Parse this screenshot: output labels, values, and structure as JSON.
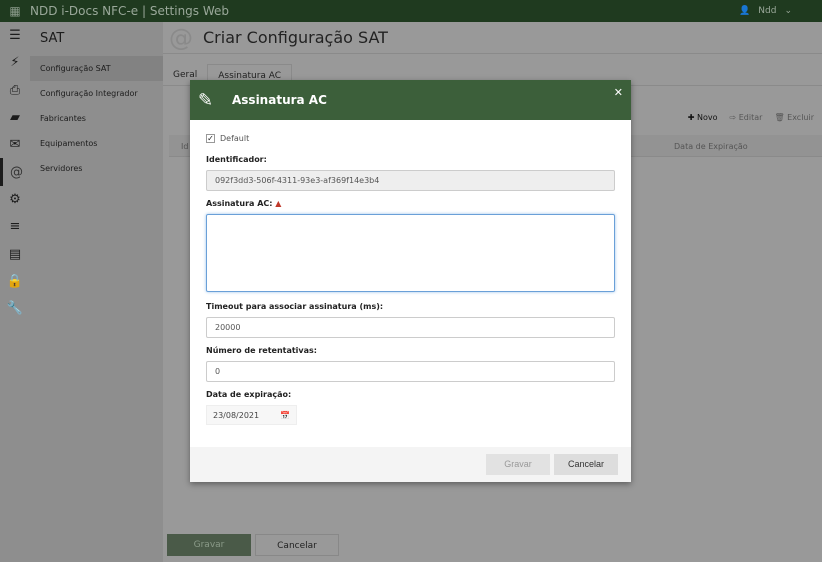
{
  "app": {
    "title": "NDD i-Docs NFC-e | Settings Web",
    "user": "Ndd"
  },
  "iconbar": [
    "menu-icon",
    "plug-icon",
    "printer-icon",
    "folder-icon",
    "envelope-icon",
    "at-icon",
    "gear-icon",
    "sliders-icon",
    "server-icon",
    "lock-icon",
    "wrench-icon"
  ],
  "nav": {
    "title": "SAT",
    "items": [
      "Configuração SAT",
      "Configuração Integrador",
      "Fabricantes",
      "Equipamentos",
      "Servidores"
    ],
    "selected": "Configuração SAT"
  },
  "page": {
    "title": "Criar Configuração SAT",
    "tabs": [
      "Geral",
      "Assinatura AC"
    ],
    "active_tab": "Assinatura AC",
    "toolbar": {
      "new": "Novo",
      "edit": "Editar",
      "delete": "Excluir"
    },
    "grid_columns": [
      "Id",
      "Data de Expiração"
    ],
    "save": "Gravar",
    "cancel": "Cancelar"
  },
  "modal": {
    "title": "Assinatura AC",
    "default_label": "Default",
    "default_checked": true,
    "identificador_label": "Identificador:",
    "identificador_value": "092f3dd3-506f-4311-93e3-af369f14e3b4",
    "assinatura_label": "Assinatura AC:",
    "assinatura_value": "",
    "timeout_label": "Timeout para associar assinatura (ms):",
    "timeout_value": "20000",
    "retries_label": "Número de retentativas:",
    "retries_value": "0",
    "expiry_label": "Data de expiração:",
    "expiry_value": "23/08/2021",
    "save": "Gravar",
    "cancel": "Cancelar"
  },
  "colors": {
    "header": "#3c5f3a",
    "topbar": "#1f3a1f",
    "warning": "#c0392b"
  }
}
